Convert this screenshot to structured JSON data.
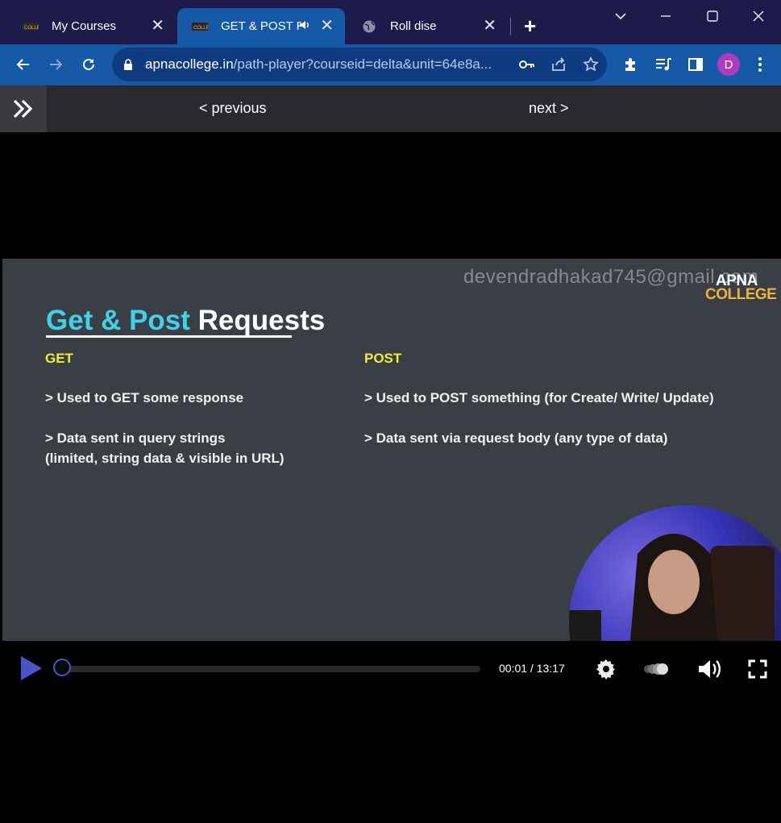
{
  "browser": {
    "tabs": [
      {
        "title": "My Courses",
        "close": "✕"
      },
      {
        "title": "GET & POST Re",
        "close": "✕"
      },
      {
        "title": "Roll dise",
        "close": "✕"
      }
    ],
    "new_tab": "+",
    "url_domain": "apnacollege.in",
    "url_path": "/path-player?courseid=delta&unit=64e8a...",
    "profile_initial": "D",
    "colors": {
      "tabstrip": "#1e1a49",
      "toolbar": "#1659a7",
      "avatar": "#b03bbf"
    }
  },
  "course_nav": {
    "previous": "< previous",
    "next": "next >"
  },
  "slide": {
    "watermark": "devendradhakad745@gmail.com",
    "logo_line1": "APNA",
    "logo_line2": "COLLEGE",
    "title_accent": "Get & Post",
    "title_rest": "Requests",
    "get_header": "GET",
    "get_point1": "> Used to GET some response",
    "get_point2": "> Data sent in query strings",
    "get_point3": "(limited, string data & visible in URL)",
    "post_header": "POST",
    "post_point1": "> Used to POST something (for Create/ Write/ Update)",
    "post_point2": "> Data sent via request body (any type of data)"
  },
  "player": {
    "time": "00:01 / 13:17",
    "progress": 0.001
  }
}
